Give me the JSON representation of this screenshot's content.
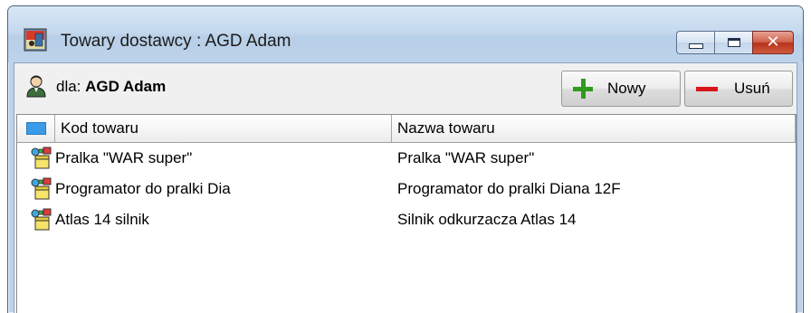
{
  "window": {
    "title": "Towary dostawcy : AGD Adam",
    "icon": "supplier-goods-icon",
    "caption_buttons": [
      "minimize",
      "maximize",
      "close"
    ]
  },
  "toolbar": {
    "for_prefix": "dla:",
    "vendor_name": "AGD Adam",
    "new_label": "Nowy",
    "delete_label": "Usuń"
  },
  "table": {
    "columns": [
      "Kod towaru",
      "Nazwa towaru"
    ],
    "rows": [
      {
        "code": "Pralka \"WAR super\"",
        "name": "Pralka \"WAR super\"",
        "icon": "goods-icon"
      },
      {
        "code": "Programator do pralki Dia",
        "name": "Programator do pralki Diana 12F",
        "icon": "goods-icon"
      },
      {
        "code": "Atlas 14 silnik",
        "name": "Silnik odkurzacza Atlas 14",
        "icon": "goods-icon"
      }
    ]
  },
  "colors": {
    "add": "#2f9b1e",
    "delete": "#d8161a",
    "selection_marker": "#3a9be8",
    "close_button": "#c7432a"
  }
}
